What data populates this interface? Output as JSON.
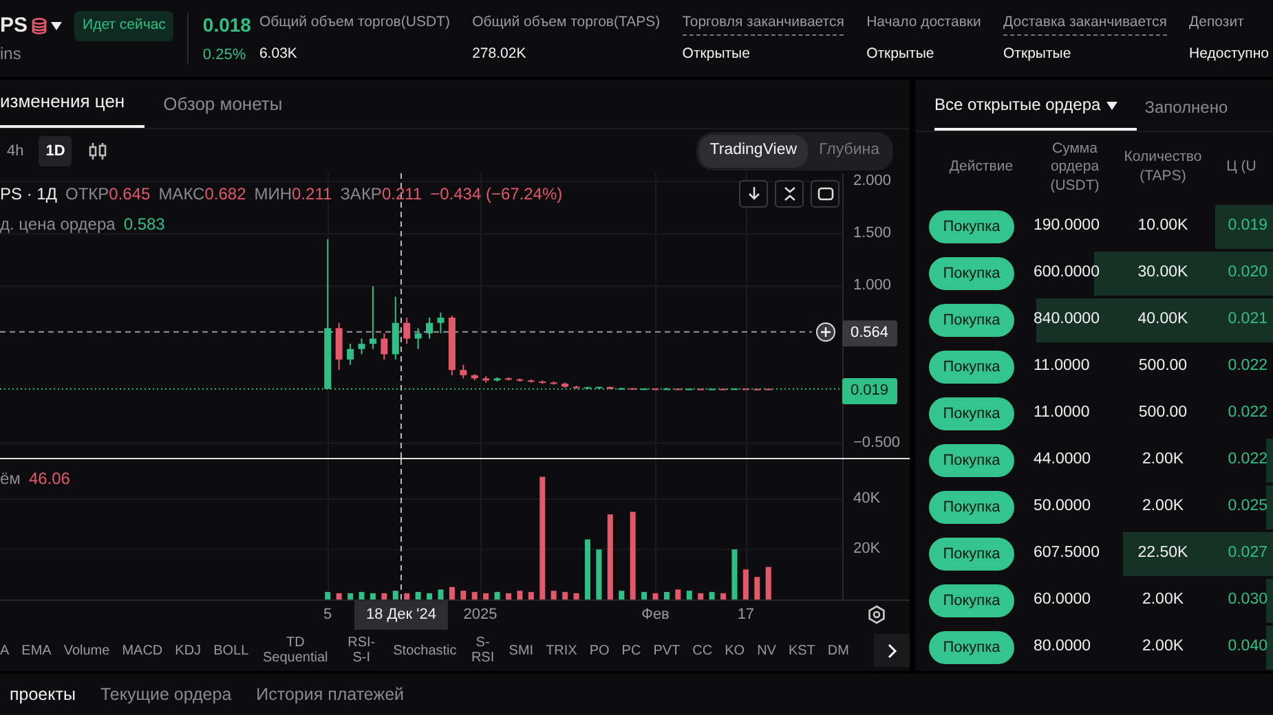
{
  "header": {
    "symbol": "PS",
    "subtitle": "ins",
    "status_badge": "Идет сейчас",
    "price": "0.018",
    "change": "0.25%",
    "stats": [
      {
        "label": "Общий объем торгов(USDT)",
        "value": "6.03K",
        "underlined": false
      },
      {
        "label": "Общий объем торгов(TAPS)",
        "value": "278.02K",
        "underlined": false
      },
      {
        "label": "Торговля заканчивается",
        "value": "Открытые",
        "underlined": true
      },
      {
        "label": "Начало доставки",
        "value": "Открытые",
        "underlined": false
      },
      {
        "label": "Доставка заканчивается",
        "value": "Открытые",
        "underlined": true
      },
      {
        "label": "Депозит",
        "value": "Недоступно",
        "underlined": false
      }
    ]
  },
  "chart_panel": {
    "tabs": [
      {
        "label": "изменения цен",
        "selected": true
      },
      {
        "label": "Обзор монеты",
        "selected": false
      }
    ],
    "intervals": [
      {
        "label": "4h",
        "selected": false
      },
      {
        "label": "1D",
        "selected": true
      }
    ],
    "view_toggle": [
      {
        "label": "TradingView",
        "selected": true
      },
      {
        "label": "Глубина",
        "selected": false
      }
    ],
    "legend": {
      "title": "PS · 1Д",
      "items": [
        {
          "label": "ОТКР",
          "value": "0.645"
        },
        {
          "label": "МАКС",
          "value": "0.682"
        },
        {
          "label": "МИН",
          "value": "0.211"
        },
        {
          "label": "ЗАКР",
          "value": "0.211"
        }
      ],
      "change": "−0.434 (−67.24%)"
    },
    "order_price": {
      "label": "д. цена ордера",
      "value": "0.583"
    },
    "chart_data": {
      "type": "candlestick",
      "x": [
        "2024-12-05",
        "2024-12-07",
        "2024-12-09",
        "2024-12-11",
        "2024-12-13",
        "2024-12-15",
        "2024-12-17",
        "2024-12-19",
        "2024-12-21",
        "2024-12-23",
        "2024-12-25",
        "2024-12-27",
        "2024-12-29",
        "2024-12-31",
        "2025-01-02",
        "2025-01-04",
        "2025-01-06",
        "2025-01-08",
        "2025-01-10",
        "2025-01-12",
        "2025-01-14",
        "2025-01-16",
        "2025-01-18",
        "2025-01-20",
        "2025-01-22",
        "2025-01-24",
        "2025-01-26",
        "2025-01-28",
        "2025-01-30",
        "2025-02-01",
        "2025-02-03",
        "2025-02-05",
        "2025-02-07",
        "2025-02-09",
        "2025-02-11",
        "2025-02-13",
        "2025-02-15",
        "2025-02-17",
        "2025-02-19",
        "2025-02-21"
      ],
      "ohlc": [
        [
          0.019,
          1.45,
          0.019,
          0.6
        ],
        [
          0.6,
          0.65,
          0.2,
          0.3
        ],
        [
          0.3,
          0.45,
          0.25,
          0.4
        ],
        [
          0.4,
          0.5,
          0.35,
          0.45
        ],
        [
          0.45,
          1.0,
          0.4,
          0.5
        ],
        [
          0.5,
          0.55,
          0.3,
          0.35
        ],
        [
          0.35,
          0.9,
          0.3,
          0.65
        ],
        [
          0.65,
          0.7,
          0.45,
          0.5
        ],
        [
          0.5,
          0.6,
          0.4,
          0.55
        ],
        [
          0.55,
          0.7,
          0.5,
          0.65
        ],
        [
          0.65,
          0.75,
          0.55,
          0.7
        ],
        [
          0.7,
          0.72,
          0.15,
          0.2
        ],
        [
          0.2,
          0.25,
          0.12,
          0.15
        ],
        [
          0.15,
          0.16,
          0.1,
          0.12
        ],
        [
          0.12,
          0.14,
          0.08,
          0.1
        ],
        [
          0.1,
          0.13,
          0.09,
          0.12
        ],
        [
          0.12,
          0.13,
          0.1,
          0.11
        ],
        [
          0.11,
          0.12,
          0.09,
          0.1
        ],
        [
          0.1,
          0.11,
          0.08,
          0.09
        ],
        [
          0.09,
          0.1,
          0.07,
          0.08
        ],
        [
          0.08,
          0.09,
          0.06,
          0.07
        ],
        [
          0.07,
          0.08,
          0.03,
          0.04
        ],
        [
          0.04,
          0.05,
          0.02,
          0.03
        ],
        [
          0.03,
          0.04,
          0.02,
          0.035
        ],
        [
          0.035,
          0.04,
          0.02,
          0.038
        ],
        [
          0.038,
          0.04,
          0.015,
          0.02
        ],
        [
          0.02,
          0.03,
          0.015,
          0.025
        ],
        [
          0.025,
          0.026,
          0.015,
          0.018
        ],
        [
          0.018,
          0.024,
          0.016,
          0.022
        ],
        [
          0.022,
          0.023,
          0.017,
          0.019
        ],
        [
          0.019,
          0.03,
          0.017,
          0.021
        ],
        [
          0.021,
          0.022,
          0.016,
          0.018
        ],
        [
          0.018,
          0.022,
          0.016,
          0.02
        ],
        [
          0.02,
          0.021,
          0.016,
          0.018
        ],
        [
          0.018,
          0.021,
          0.016,
          0.02
        ],
        [
          0.02,
          0.021,
          0.017,
          0.019
        ],
        [
          0.019,
          0.024,
          0.017,
          0.022
        ],
        [
          0.022,
          0.023,
          0.017,
          0.019
        ],
        [
          0.019,
          0.02,
          0.016,
          0.018
        ],
        [
          0.02,
          0.021,
          0.018,
          0.019
        ]
      ],
      "xlim": [
        "2024-10-08",
        "2025-03-18"
      ],
      "ylim": [
        -0.64,
        2.08
      ],
      "grid": true,
      "ref_lines": [
        {
          "axis": "y",
          "value": 0.564
        },
        {
          "axis": "y",
          "value": 0.019
        },
        {
          "axis": "x",
          "value": "2024-12-18"
        }
      ],
      "yticks": [
        {
          "value": 2,
          "label": "2.000"
        },
        {
          "value": 1.5,
          "label": "1.500"
        },
        {
          "value": 1,
          "label": "1.000"
        },
        {
          "value": -0.5,
          "label": "−0.500"
        }
      ]
    },
    "crosshair_price": "0.564",
    "last_price": "0.019",
    "volume": {
      "label": "ём",
      "value": "46.06",
      "chart_data": {
        "type": "bar",
        "x": [
          "2024-12-05",
          "2024-12-07",
          "2024-12-09",
          "2024-12-11",
          "2024-12-13",
          "2024-12-15",
          "2024-12-17",
          "2024-12-19",
          "2024-12-21",
          "2024-12-23",
          "2024-12-25",
          "2024-12-27",
          "2024-12-29",
          "2024-12-31",
          "2025-01-02",
          "2025-01-04",
          "2025-01-06",
          "2025-01-08",
          "2025-01-10",
          "2025-01-12",
          "2025-01-14",
          "2025-01-16",
          "2025-01-18",
          "2025-01-20",
          "2025-01-22",
          "2025-01-24",
          "2025-01-26",
          "2025-01-28",
          "2025-01-30",
          "2025-02-01",
          "2025-02-03",
          "2025-02-05",
          "2025-02-07",
          "2025-02-09",
          "2025-02-11",
          "2025-02-13",
          "2025-02-15",
          "2025-02-17",
          "2025-02-19",
          "2025-02-21"
        ],
        "values": [
          3000,
          2500,
          2500,
          3000,
          2500,
          2500,
          3500,
          2500,
          3000,
          2500,
          4000,
          5000,
          3500,
          3000,
          2500,
          3000,
          2500,
          3500,
          3000,
          49000,
          3500,
          3000,
          2500,
          24000,
          20000,
          34000,
          3500,
          35000,
          3000,
          2500,
          3000,
          4000,
          3500,
          2500,
          3000,
          2500,
          20000,
          12000,
          9000,
          13000
        ],
        "xlim": [
          "2024-10-08",
          "2025-03-18"
        ],
        "ylim": [
          0,
          56000
        ],
        "grid": true,
        "ref_lines": [
          {
            "axis": "x",
            "value": "2024-12-18"
          }
        ],
        "xticks": [
          {
            "value": "2024-12-05",
            "label": "5"
          },
          {
            "value": "2025-01-01",
            "label": "2025"
          },
          {
            "value": "2025-02-01",
            "label": "Фев"
          },
          {
            "value": "2025-02-17",
            "label": "17"
          }
        ],
        "yticks": [
          {
            "value": 40000,
            "label": "40K"
          },
          {
            "value": 20000,
            "label": "20K"
          }
        ]
      }
    },
    "crosshair_date": "18 Дек '24",
    "indicators": [
      "A",
      "EMA",
      "Volume",
      "MACD",
      "KDJ",
      "BOLL",
      "TD Sequential",
      "RSI-S-I",
      "Stochastic",
      "S-RSI",
      "SMI",
      "TRIX",
      "PO",
      "PC",
      "PVT",
      "CC",
      "KO",
      "NV",
      "KST",
      "DM"
    ]
  },
  "bottom_tabs": [
    {
      "label": "проекты",
      "selected": true
    },
    {
      "label": "Текущие ордера",
      "selected": false
    },
    {
      "label": "История платежей",
      "selected": false
    }
  ],
  "orders": {
    "tabs": [
      {
        "label": "Все открытые ордера",
        "selected": true
      },
      {
        "label": "Заполнено",
        "selected": false
      }
    ],
    "columns": [
      "Действие",
      "Сумма ордера (USDT)",
      "Количество (TAPS)",
      "Ц (U"
    ],
    "rows": [
      {
        "action": "Покупка",
        "amount": "190.0000",
        "quantity": "10.00K",
        "price": "0.019",
        "level": 0.16
      },
      {
        "action": "Покупка",
        "amount": "600.0000",
        "quantity": "30.00K",
        "price": "0.020",
        "level": 0.5
      },
      {
        "action": "Покупка",
        "amount": "840.0000",
        "quantity": "40.00K",
        "price": "0.021",
        "level": 0.66
      },
      {
        "action": "Покупка",
        "amount": "11.0000",
        "quantity": "500.00",
        "price": "0.022",
        "level": 0
      },
      {
        "action": "Покупка",
        "amount": "11.0000",
        "quantity": "500.00",
        "price": "0.022",
        "level": 0
      },
      {
        "action": "Покупка",
        "amount": "44.0000",
        "quantity": "2.00K",
        "price": "0.022",
        "level": 0.02
      },
      {
        "action": "Покупка",
        "amount": "50.0000",
        "quantity": "2.00K",
        "price": "0.025",
        "level": 0.02
      },
      {
        "action": "Покупка",
        "amount": "607.5000",
        "quantity": "22.50K",
        "price": "0.027",
        "level": 0.42
      },
      {
        "action": "Покупка",
        "amount": "60.0000",
        "quantity": "2.00K",
        "price": "0.030",
        "level": 0.02
      },
      {
        "action": "Покупка",
        "amount": "80.0000",
        "quantity": "2.00K",
        "price": "0.040",
        "level": 0.02
      }
    ]
  }
}
